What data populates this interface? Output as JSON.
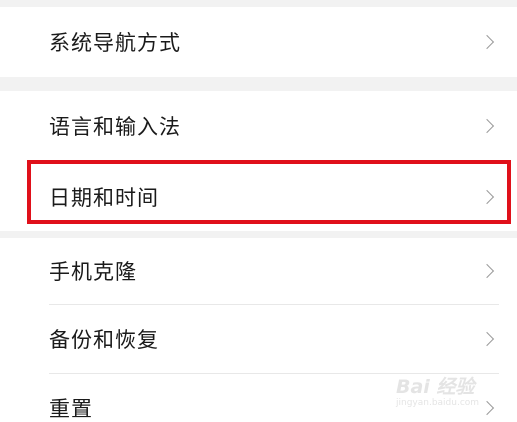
{
  "settings": {
    "group1": [
      {
        "label": "系统导航方式",
        "icon": "chevron-right-icon"
      }
    ],
    "group2": [
      {
        "label": "语言和输入法",
        "icon": "chevron-right-icon"
      },
      {
        "label": "日期和时间",
        "icon": "chevron-right-icon",
        "highlighted": true
      }
    ],
    "group3": [
      {
        "label": "手机克隆",
        "icon": "chevron-right-icon"
      },
      {
        "label": "备份和恢复",
        "icon": "chevron-right-icon"
      },
      {
        "label": "重置",
        "icon": "chevron-right-icon"
      }
    ]
  },
  "colors": {
    "highlight": "#e0101a",
    "separator": "#f2f2f2",
    "text": "#1a1a1a",
    "chevron": "#9a9a9a"
  },
  "watermark": {
    "main": "Bai 经验",
    "sub": "jingyan.baidu.com"
  }
}
